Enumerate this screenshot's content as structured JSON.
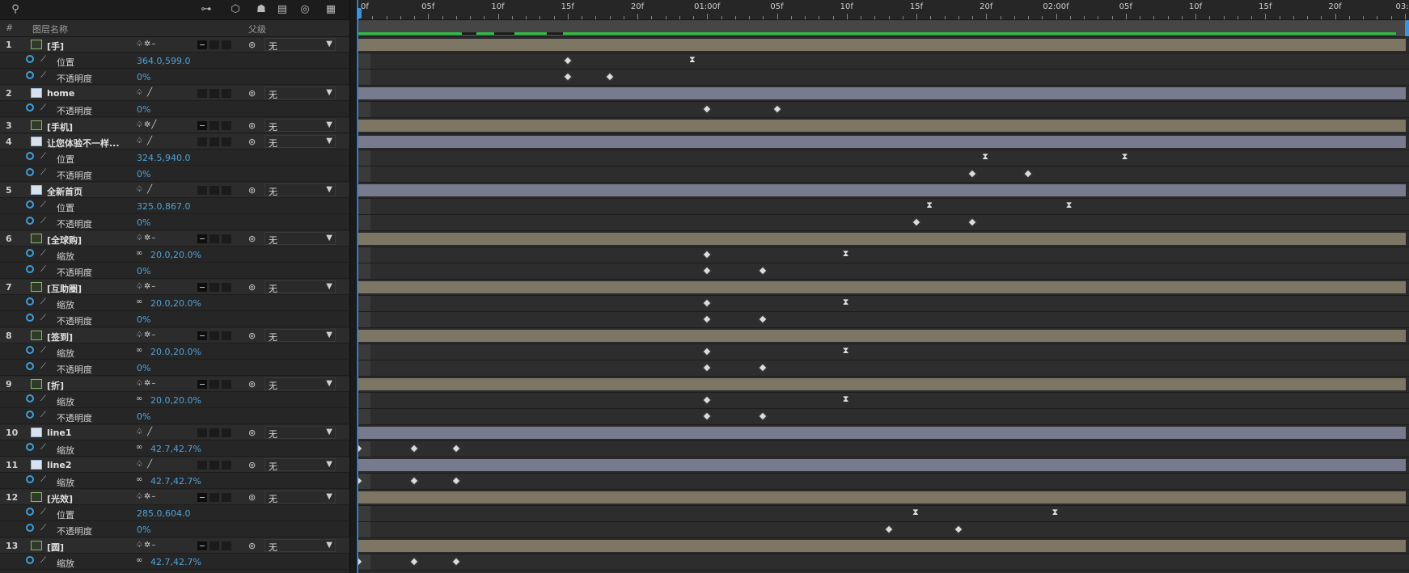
{
  "toolbar": {
    "search_icon": "search-icon",
    "icons": [
      "hierarchy-icon",
      "3d-cube-icon",
      "shy-icon",
      "frame-blend-icon",
      "motion-blur-icon",
      "graph-editor-icon"
    ]
  },
  "columns": {
    "num": "#",
    "name": "图层名称",
    "parent": "父级"
  },
  "ruler": {
    "labels": [
      "0f",
      "05f",
      "10f",
      "15f",
      "20f",
      "01:00f",
      "05f",
      "10f",
      "15f",
      "20f",
      "02:00f",
      "05f",
      "10f",
      "15f",
      "20f",
      "03:0"
    ]
  },
  "colors": {
    "accent": "#3e9fd8",
    "av_bar": "#7d7665",
    "text_bar": "#787a8e",
    "cache": "#2fbf44",
    "value": "#4ea3d9"
  },
  "rows": [
    {
      "kind": "layer",
      "num": "1",
      "name": "[手]",
      "icon": "image",
      "switches": "♤✲–",
      "parent": "无",
      "bar": "av"
    },
    {
      "kind": "prop",
      "name": "位置",
      "value": "364.0,599.0",
      "link": false,
      "keys": [
        {
          "f": 15,
          "t": "d"
        },
        {
          "f": 24,
          "t": "h"
        }
      ]
    },
    {
      "kind": "prop",
      "name": "不透明度",
      "value": "0%",
      "link": false,
      "keys": [
        {
          "f": 15,
          "t": "d"
        },
        {
          "f": 18,
          "t": "d"
        }
      ]
    },
    {
      "kind": "layer",
      "num": "2",
      "name": "home",
      "icon": "text",
      "switches": "♤ ╱",
      "parent": "无",
      "bar": "txt"
    },
    {
      "kind": "prop",
      "name": "不透明度",
      "value": "0%",
      "link": false,
      "keys": [
        {
          "f": 25,
          "t": "d"
        },
        {
          "f": 30,
          "t": "d"
        }
      ]
    },
    {
      "kind": "layer",
      "num": "3",
      "name": "[手机]",
      "icon": "image",
      "switches": "♤✲╱",
      "parent": "无",
      "bar": "av"
    },
    {
      "kind": "layer",
      "num": "4",
      "name": "让您体验不一样...",
      "icon": "text",
      "switches": "♤ ╱",
      "parent": "无",
      "bar": "txt"
    },
    {
      "kind": "prop",
      "name": "位置",
      "value": "324.5,940.0",
      "link": false,
      "keys": [
        {
          "f": 45,
          "t": "h"
        },
        {
          "f": 55,
          "t": "h"
        }
      ]
    },
    {
      "kind": "prop",
      "name": "不透明度",
      "value": "0%",
      "link": false,
      "keys": [
        {
          "f": 44,
          "t": "d"
        },
        {
          "f": 48,
          "t": "d"
        }
      ]
    },
    {
      "kind": "layer",
      "num": "5",
      "name": "全新首页",
      "icon": "text",
      "switches": "♤ ╱",
      "parent": "无",
      "bar": "txt"
    },
    {
      "kind": "prop",
      "name": "位置",
      "value": "325.0,867.0",
      "link": false,
      "keys": [
        {
          "f": 41,
          "t": "h"
        },
        {
          "f": 51,
          "t": "h"
        }
      ]
    },
    {
      "kind": "prop",
      "name": "不透明度",
      "value": "0%",
      "link": false,
      "keys": [
        {
          "f": 40,
          "t": "d"
        },
        {
          "f": 44,
          "t": "d"
        }
      ]
    },
    {
      "kind": "layer",
      "num": "6",
      "name": "[全球购]",
      "icon": "image",
      "switches": "♤✲–",
      "parent": "无",
      "bar": "av"
    },
    {
      "kind": "prop",
      "name": "缩放",
      "value": "20.0,20.0%",
      "link": true,
      "keys": [
        {
          "f": 25,
          "t": "d"
        },
        {
          "f": 35,
          "t": "h"
        }
      ]
    },
    {
      "kind": "prop",
      "name": "不透明度",
      "value": "0%",
      "link": false,
      "keys": [
        {
          "f": 25,
          "t": "d"
        },
        {
          "f": 29,
          "t": "d"
        }
      ]
    },
    {
      "kind": "layer",
      "num": "7",
      "name": "[互助圈]",
      "icon": "image",
      "switches": "♤✲–",
      "parent": "无",
      "bar": "av"
    },
    {
      "kind": "prop",
      "name": "缩放",
      "value": "20.0,20.0%",
      "link": true,
      "keys": [
        {
          "f": 25,
          "t": "d"
        },
        {
          "f": 35,
          "t": "h"
        }
      ]
    },
    {
      "kind": "prop",
      "name": "不透明度",
      "value": "0%",
      "link": false,
      "keys": [
        {
          "f": 25,
          "t": "d"
        },
        {
          "f": 29,
          "t": "d"
        }
      ]
    },
    {
      "kind": "layer",
      "num": "8",
      "name": "[签到]",
      "icon": "image",
      "switches": "♤✲–",
      "parent": "无",
      "bar": "av"
    },
    {
      "kind": "prop",
      "name": "缩放",
      "value": "20.0,20.0%",
      "link": true,
      "keys": [
        {
          "f": 25,
          "t": "d"
        },
        {
          "f": 35,
          "t": "h"
        }
      ]
    },
    {
      "kind": "prop",
      "name": "不透明度",
      "value": "0%",
      "link": false,
      "keys": [
        {
          "f": 25,
          "t": "d"
        },
        {
          "f": 29,
          "t": "d"
        }
      ]
    },
    {
      "kind": "layer",
      "num": "9",
      "name": "[折]",
      "icon": "image",
      "switches": "♤✲–",
      "parent": "无",
      "bar": "av"
    },
    {
      "kind": "prop",
      "name": "缩放",
      "value": "20.0,20.0%",
      "link": true,
      "keys": [
        {
          "f": 25,
          "t": "d"
        },
        {
          "f": 35,
          "t": "h"
        }
      ]
    },
    {
      "kind": "prop",
      "name": "不透明度",
      "value": "0%",
      "link": false,
      "keys": [
        {
          "f": 25,
          "t": "d"
        },
        {
          "f": 29,
          "t": "d"
        }
      ]
    },
    {
      "kind": "layer",
      "num": "10",
      "name": "line1",
      "icon": "text",
      "switches": "♤ ╱",
      "parent": "无",
      "bar": "txt"
    },
    {
      "kind": "prop",
      "name": "缩放",
      "value": "42.7,42.7%",
      "link": true,
      "keys": [
        {
          "f": 0,
          "t": "d"
        },
        {
          "f": 4,
          "t": "d"
        },
        {
          "f": 7,
          "t": "d"
        }
      ]
    },
    {
      "kind": "layer",
      "num": "11",
      "name": "line2",
      "icon": "text",
      "switches": "♤ ╱",
      "parent": "无",
      "bar": "txt"
    },
    {
      "kind": "prop",
      "name": "缩放",
      "value": "42.7,42.7%",
      "link": true,
      "keys": [
        {
          "f": 0,
          "t": "d"
        },
        {
          "f": 4,
          "t": "d"
        },
        {
          "f": 7,
          "t": "d"
        }
      ]
    },
    {
      "kind": "layer",
      "num": "12",
      "name": "[光效]",
      "icon": "image",
      "switches": "♤✲–",
      "parent": "无",
      "bar": "av"
    },
    {
      "kind": "prop",
      "name": "位置",
      "value": "285.0,604.0",
      "link": false,
      "keys": [
        {
          "f": 40,
          "t": "h"
        },
        {
          "f": 50,
          "t": "h"
        }
      ]
    },
    {
      "kind": "prop",
      "name": "不透明度",
      "value": "0%",
      "link": false,
      "keys": [
        {
          "f": 38,
          "t": "d"
        },
        {
          "f": 43,
          "t": "d"
        }
      ]
    },
    {
      "kind": "layer",
      "num": "13",
      "name": "[圆]",
      "icon": "image",
      "switches": "♤✲–",
      "parent": "无",
      "bar": "av"
    },
    {
      "kind": "prop",
      "name": "缩放",
      "value": "42.7,42.7%",
      "link": true,
      "keys": [
        {
          "f": 0,
          "t": "d"
        },
        {
          "f": 4,
          "t": "d"
        },
        {
          "f": 7,
          "t": "d"
        }
      ]
    }
  ]
}
